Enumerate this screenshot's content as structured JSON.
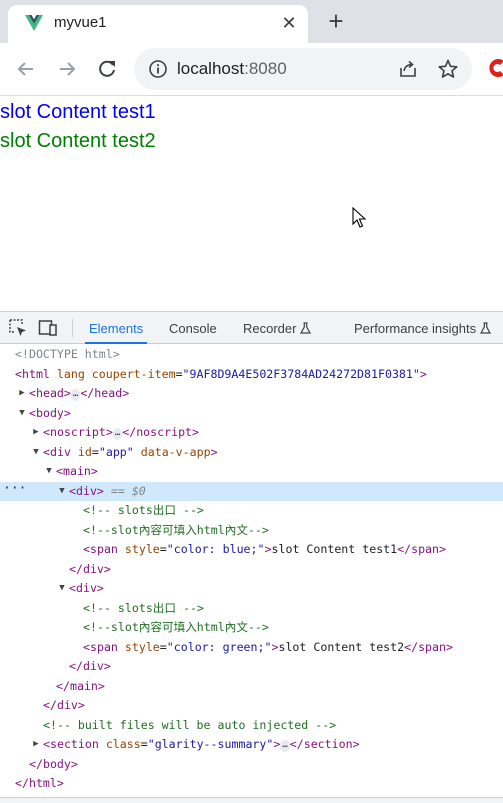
{
  "browser": {
    "tab_title": "myvue1",
    "url_host": "localhost",
    "url_port": ":8080"
  },
  "page": {
    "lines": [
      "slot Content test1",
      "slot Content test2"
    ],
    "colors": {
      "line1": "#0000ff",
      "line2": "#008000"
    }
  },
  "devtools": {
    "tabs": [
      "Elements",
      "Console",
      "Recorder",
      "Performance insights"
    ],
    "active_tab": "Elements",
    "dom": {
      "doctype": "<!DOCTYPE html>",
      "html_open": {
        "tag": "<html",
        "attr1_name": "lang",
        "attr2_name": "coupert-item",
        "attr2_value": "\"9AF8D9A4E502F3784AD24272D81F0381\"",
        "close": ">"
      },
      "head_open": "<head>",
      "head_close": "</head>",
      "body_open": "<body>",
      "noscript_open": "<noscript>",
      "noscript_close": "</noscript>",
      "div_app": {
        "open": "<div",
        "id_name": "id",
        "id_value": "\"app\"",
        "flag": "data-v-app",
        "close": ">"
      },
      "main_open": "<main>",
      "div_open": "<div>",
      "selected_marker": "== $0",
      "comment_slots": "<!-- slots出口 -->",
      "comment_slot_content": "<!--slot內容可填入html內文-->",
      "span1": {
        "open": "<span",
        "attr_name": "style",
        "attr_value": "\"color: blue;\"",
        "gt": ">",
        "text": "slot Content test1",
        "close": "</span>"
      },
      "span2": {
        "open": "<span",
        "attr_name": "style",
        "attr_value": "\"color: green;\"",
        "gt": ">",
        "text": "slot Content test2",
        "close": "</span>"
      },
      "div_close": "</div>",
      "main_close": "</main>",
      "comment_built": "<!-- built files will be auto injected -->",
      "section": {
        "open": "<section",
        "attr_name": "class",
        "attr_value": "\"glarity--summary\"",
        "gt": ">",
        "close": "</section>"
      },
      "body_close": "</body>",
      "html_close": "</html>",
      "ellipsis": "…",
      "equals": "="
    }
  }
}
